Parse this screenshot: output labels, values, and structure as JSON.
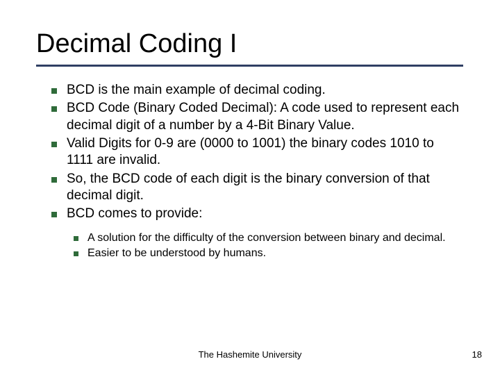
{
  "title": "Decimal Coding I",
  "bullets": {
    "b0": "BCD is the main example of decimal coding.",
    "b1": "BCD Code (Binary Coded Decimal): A code used to represent each decimal digit of a number by a 4-Bit Binary Value.",
    "b2": "Valid Digits for 0-9 are (0000 to 1001) the binary codes 1010 to 1111 are invalid.",
    "b3": "So, the BCD code of each digit is the binary conversion of that decimal digit.",
    "b4": "BCD comes to provide:"
  },
  "sub_bullets": {
    "s0": "A solution for the difficulty of the conversion between binary and decimal.",
    "s1": "Easier to be understood by humans."
  },
  "footer": {
    "center": "The Hashemite University",
    "page": "18"
  }
}
